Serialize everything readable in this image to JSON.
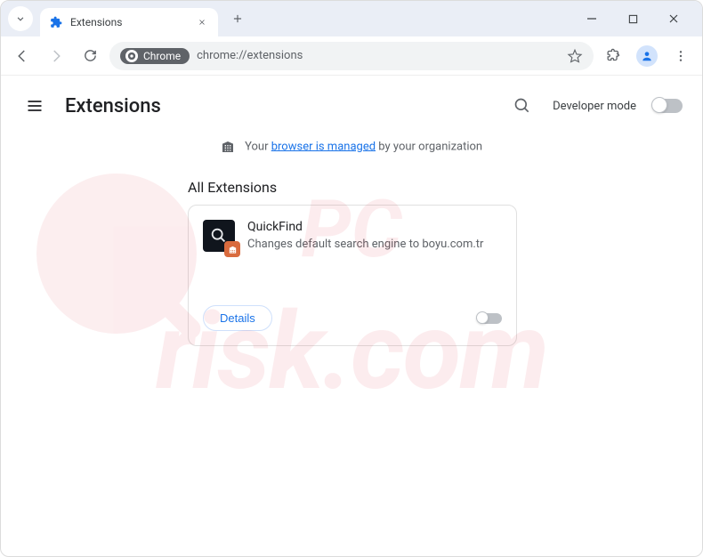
{
  "tab": {
    "title": "Extensions"
  },
  "omnibox": {
    "chip": "Chrome",
    "url": "chrome://extensions"
  },
  "page": {
    "title": "Extensions",
    "dev_mode_label": "Developer mode",
    "managed_prefix": "Your ",
    "managed_link": "browser is managed",
    "managed_suffix": " by your organization",
    "section": "All Extensions"
  },
  "extension": {
    "name": "QuickFind",
    "description": "Changes default search engine to boyu.com.tr",
    "details_label": "Details",
    "enabled": false
  },
  "watermark": {
    "top": "PC",
    "bottom": "risk.com"
  }
}
